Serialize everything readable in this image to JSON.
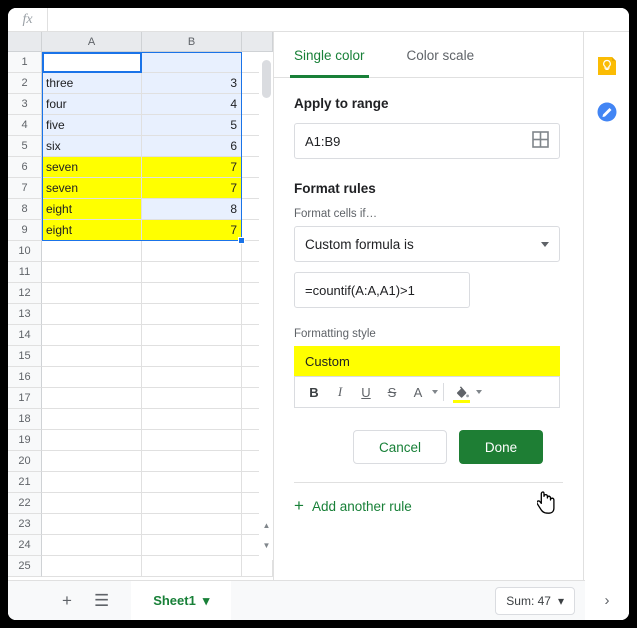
{
  "formula_bar": {
    "fx_label": "fx",
    "value": "",
    "placeholder": ""
  },
  "grid": {
    "columns": [
      "A",
      "B"
    ],
    "active_cell": "A1",
    "selection_range": "A1:B9",
    "rows": [
      {
        "num": "1",
        "a": "",
        "b": "",
        "a_hl": false,
        "b_hl": false,
        "selected": true
      },
      {
        "num": "2",
        "a": "three",
        "b": "3",
        "a_hl": false,
        "b_hl": false,
        "selected": true
      },
      {
        "num": "3",
        "a": "four",
        "b": "4",
        "a_hl": false,
        "b_hl": false,
        "selected": true
      },
      {
        "num": "4",
        "a": "five",
        "b": "5",
        "a_hl": false,
        "b_hl": false,
        "selected": true
      },
      {
        "num": "5",
        "a": "six",
        "b": "6",
        "a_hl": false,
        "b_hl": false,
        "selected": true
      },
      {
        "num": "6",
        "a": "seven",
        "b": "7",
        "a_hl": true,
        "b_hl": true,
        "selected": true
      },
      {
        "num": "7",
        "a": "seven",
        "b": "7",
        "a_hl": true,
        "b_hl": true,
        "selected": true
      },
      {
        "num": "8",
        "a": "eight",
        "b": "8",
        "a_hl": true,
        "b_hl": false,
        "selected": true
      },
      {
        "num": "9",
        "a": "eight",
        "b": "7",
        "a_hl": true,
        "b_hl": true,
        "selected": true
      },
      {
        "num": "10",
        "a": "",
        "b": "",
        "a_hl": false,
        "b_hl": false,
        "selected": false
      },
      {
        "num": "11",
        "a": "",
        "b": "",
        "a_hl": false,
        "b_hl": false,
        "selected": false
      },
      {
        "num": "12",
        "a": "",
        "b": "",
        "a_hl": false,
        "b_hl": false,
        "selected": false
      },
      {
        "num": "13",
        "a": "",
        "b": "",
        "a_hl": false,
        "b_hl": false,
        "selected": false
      },
      {
        "num": "14",
        "a": "",
        "b": "",
        "a_hl": false,
        "b_hl": false,
        "selected": false
      },
      {
        "num": "15",
        "a": "",
        "b": "",
        "a_hl": false,
        "b_hl": false,
        "selected": false
      },
      {
        "num": "16",
        "a": "",
        "b": "",
        "a_hl": false,
        "b_hl": false,
        "selected": false
      },
      {
        "num": "17",
        "a": "",
        "b": "",
        "a_hl": false,
        "b_hl": false,
        "selected": false
      },
      {
        "num": "18",
        "a": "",
        "b": "",
        "a_hl": false,
        "b_hl": false,
        "selected": false
      },
      {
        "num": "19",
        "a": "",
        "b": "",
        "a_hl": false,
        "b_hl": false,
        "selected": false
      },
      {
        "num": "20",
        "a": "",
        "b": "",
        "a_hl": false,
        "b_hl": false,
        "selected": false
      },
      {
        "num": "21",
        "a": "",
        "b": "",
        "a_hl": false,
        "b_hl": false,
        "selected": false
      },
      {
        "num": "22",
        "a": "",
        "b": "",
        "a_hl": false,
        "b_hl": false,
        "selected": false
      },
      {
        "num": "23",
        "a": "",
        "b": "",
        "a_hl": false,
        "b_hl": false,
        "selected": false
      },
      {
        "num": "24",
        "a": "",
        "b": "",
        "a_hl": false,
        "b_hl": false,
        "selected": false
      },
      {
        "num": "25",
        "a": "",
        "b": "",
        "a_hl": false,
        "b_hl": false,
        "selected": false
      }
    ],
    "highlight_color": "#ffff00",
    "selection_color": "#e8f0fe",
    "selection_border_color": "#1a73e8"
  },
  "panel": {
    "tabs": [
      {
        "label": "Single color",
        "active": true
      },
      {
        "label": "Color scale",
        "active": false
      }
    ],
    "apply_to_range": {
      "title": "Apply to range",
      "value": "A1:B9",
      "picker_icon": "grid-select-icon"
    },
    "format_rules": {
      "title": "Format rules",
      "condition_label": "Format cells if…",
      "condition_value": "Custom formula is",
      "formula_value": "=countif(A:A,A1)>1"
    },
    "formatting_style": {
      "title": "Formatting style",
      "preview_text": "Custom",
      "preview_bg": "#ffff00",
      "toolbar": [
        {
          "name": "bold",
          "label": "B"
        },
        {
          "name": "italic",
          "label": "I"
        },
        {
          "name": "underline",
          "label": "U"
        },
        {
          "name": "strikethrough",
          "label": "S"
        },
        {
          "name": "text-color",
          "label": "A"
        },
        {
          "name": "fill-color",
          "label": ""
        }
      ],
      "fill_color": "#ffff00",
      "text_color": "#000000"
    },
    "buttons": {
      "cancel": "Cancel",
      "done": "Done"
    },
    "add_rule": {
      "plus": "+",
      "label": "Add another rule"
    },
    "accent_green": "#188038",
    "done_green": "#1e7e34"
  },
  "rail": {
    "items": [
      {
        "name": "google-keep-icon",
        "color": "#fbbc04"
      },
      {
        "name": "google-tasks-icon",
        "color": "#4285f4"
      }
    ],
    "expand_label": "›"
  },
  "bottom": {
    "add_sheet_label": "+",
    "all_sheets_label": "☰",
    "sheet_tab": {
      "name": "Sheet1",
      "caret": "▾"
    },
    "sum_badge": {
      "label": "Sum: 47",
      "caret": "▾"
    },
    "explore_icon": "explore-icon"
  }
}
